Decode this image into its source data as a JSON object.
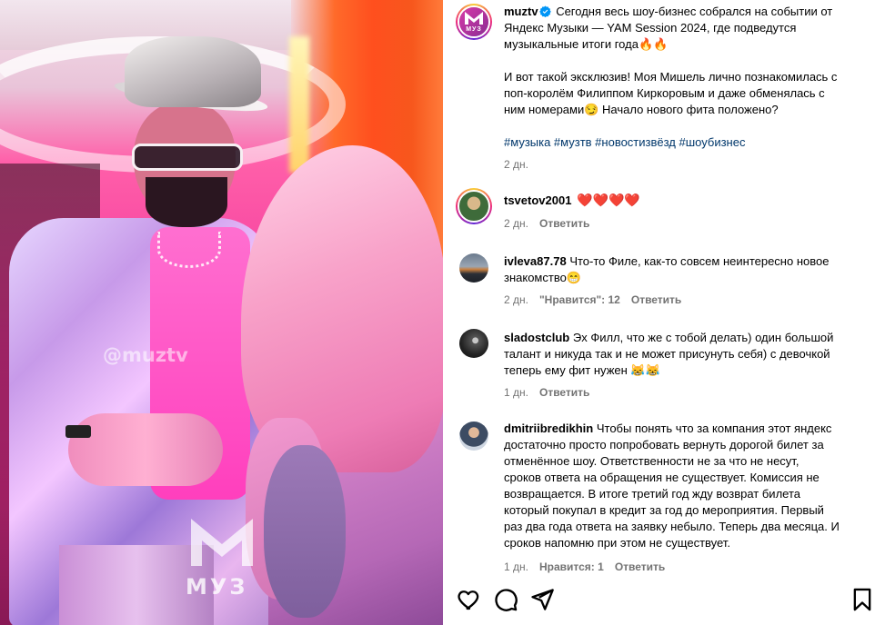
{
  "media": {
    "watermark": "@muztv",
    "logo_text": "МУЗ"
  },
  "post": {
    "author": "muztv",
    "logo_label": "МУЗ",
    "caption_lines": [
      "Сегодня весь шоу-бизнес собрался на событии от",
      "Яндекс Музыки — YAM Session 2024, где подведутся",
      "музыкальные итоги года🔥🔥"
    ],
    "caption2_lines": [
      "И вот такой эксклюзив! Моя Мишель лично познакомилась с",
      "поп-королём Филиппом Киркоровым и даже обменялась с",
      "ним номерами😏 Начало нового фита положено?"
    ],
    "hashtags": "#музыка #музтв #новостизвёзд #шоубизнес",
    "time": "2 дн."
  },
  "comments": [
    {
      "username": "tsvetov2001",
      "text": "❤️❤️❤️❤️",
      "time": "2 дн.",
      "likes": "",
      "reply": "Ответить"
    },
    {
      "username": "ivleva87.78",
      "text_lines": [
        "Что-то Филе, как-то совсем неинтересно новое",
        "знакомство😁"
      ],
      "time": "2 дн.",
      "likes": "\"Нравится\": 12",
      "reply": "Ответить"
    },
    {
      "username": "sladostclub",
      "text_lines": [
        "Эх Филл, что же с тобой делать) один большой",
        "талант и никуда так и не может присунуть себя) с девочкой",
        "теперь ему фит нужен 😹😹"
      ],
      "time": "1 дн.",
      "likes": "",
      "reply": "Ответить"
    },
    {
      "username": "dmitriibredikhin",
      "text_lines": [
        "Чтобы понять что за компания этот яндекс",
        "достаточно просто попробовать вернуть дорогой билет за",
        "отменённое шоу. Ответственности не за что не несут,",
        "сроков ответа на обращения не существует. Комиссия не",
        "возвращается. В итоге третий год жду возврат билета",
        "который покупал в кредит за год до мероприятия. Первый",
        "раз два года ответа на заявку небыло. Теперь два месяца. И",
        "сроков напомню при этом не существует."
      ],
      "time": "1 дн.",
      "likes": "Нравится: 1",
      "reply": "Ответить"
    }
  ],
  "actions": {
    "icons": [
      "heart-icon",
      "comment-icon",
      "share-icon",
      "bookmark-icon"
    ]
  },
  "colors": {
    "hashtag": "#00376b",
    "meta": "#737373",
    "verified": "#0095f6"
  }
}
